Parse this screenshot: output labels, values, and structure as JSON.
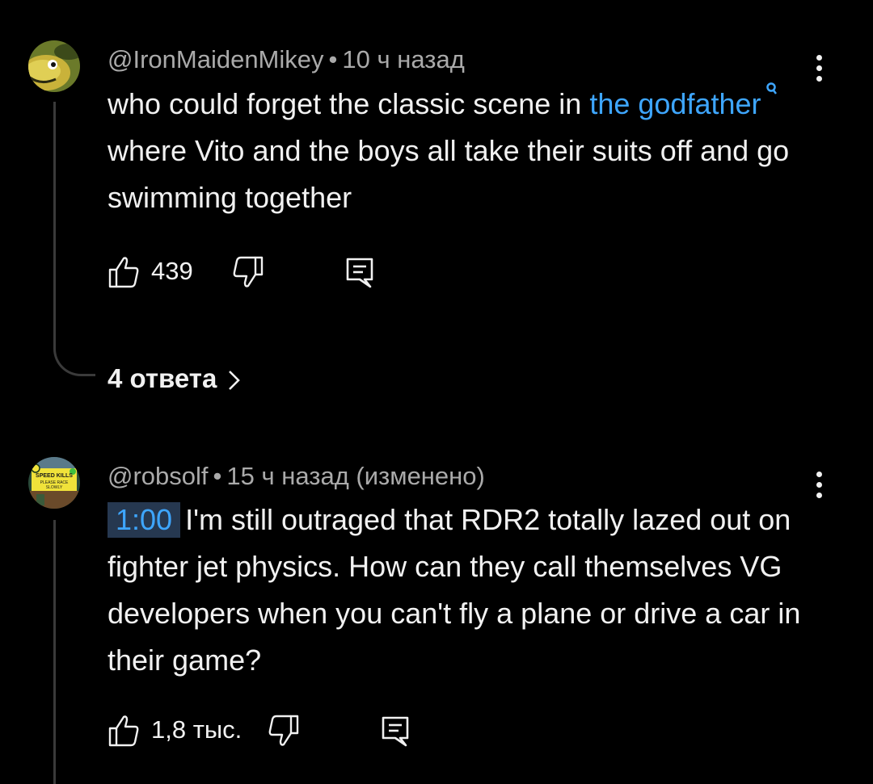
{
  "comments": [
    {
      "author": "@IronMaidenMikey",
      "time": "10 ч назад",
      "text_before_link": "who could forget the classic scene in ",
      "link_text": "the godfather",
      "text_after_link": "where Vito and the boys all take their suits off and go swimming together",
      "likes": "439",
      "replies_label": "4 ответа",
      "avatar_icon": "moray-eel-avatar"
    },
    {
      "author": "@robsolf",
      "time": "15 ч назад (изменено)",
      "timestamp": "1:00",
      "text": "I'm still outraged that RDR2 totally lazed out on fighter jet physics.  How can they call themselves VG developers when you can't fly a plane or drive a car in their game?",
      "likes": "1,8 тыс.",
      "avatar_icon": "speed-kills-sign-avatar",
      "avatar_sign_text": "SPEED KILLS PLEASE RACE SLOWLY"
    }
  ],
  "colors": {
    "background": "#000000",
    "text": "#f1f1f1",
    "meta": "#aaaaaa",
    "link": "#3ea6ff",
    "thread_line": "#3a3a3a",
    "timestamp_bg": "#263850"
  }
}
